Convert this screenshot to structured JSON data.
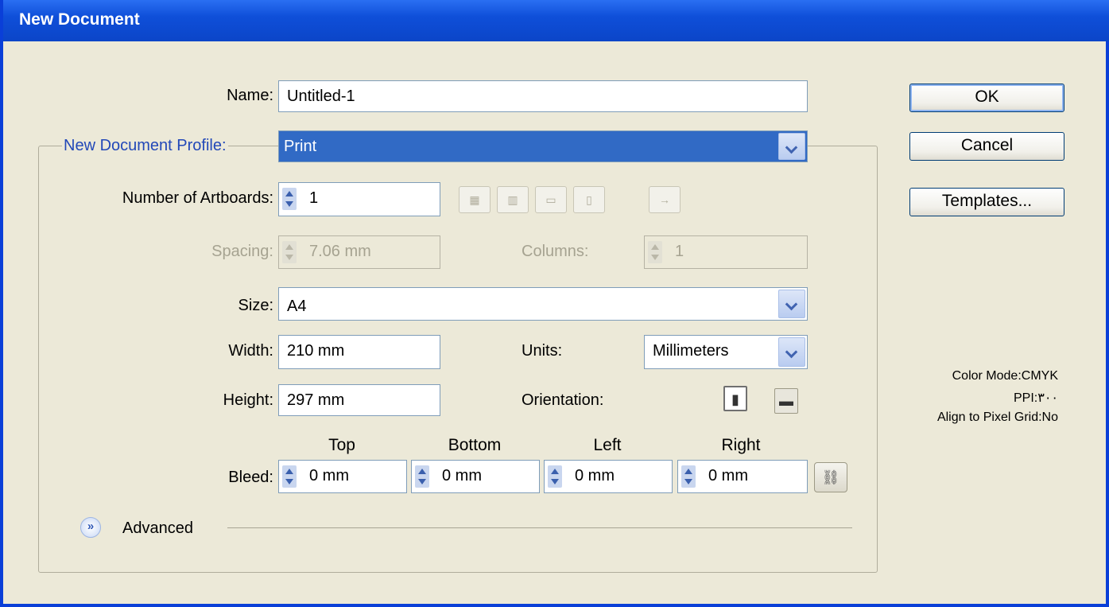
{
  "window": {
    "title": "New Document"
  },
  "name": {
    "label": "Name:",
    "value": "Untitled-1"
  },
  "profile": {
    "label": "New Document Profile:",
    "value": "Print"
  },
  "artboards": {
    "label": "Number of Artboards:",
    "value": "1",
    "arrow": "→"
  },
  "spacing": {
    "label": "Spacing:",
    "value": "7.06 mm"
  },
  "columns": {
    "label": "Columns:",
    "value": "1"
  },
  "size": {
    "label": "Size:",
    "value": "A4"
  },
  "width": {
    "label": "Width:",
    "value": "210 mm"
  },
  "height": {
    "label": "Height:",
    "value": "297 mm"
  },
  "units": {
    "label": "Units:",
    "value": "Millimeters"
  },
  "orientation": {
    "label": "Orientation:"
  },
  "bleed": {
    "label": "Bleed:",
    "columns": [
      "Top",
      "Bottom",
      "Left",
      "Right"
    ],
    "values": [
      "0 mm",
      "0 mm",
      "0 mm",
      "0 mm"
    ]
  },
  "advanced": {
    "label": "Advanced"
  },
  "buttons": {
    "ok": "OK",
    "cancel": "Cancel",
    "templates": "Templates..."
  },
  "info": {
    "color_mode": "Color Mode:CMYK",
    "ppi": "PPI:٣٠٠",
    "align": "Align to Pixel Grid:No"
  },
  "colors": {
    "title_bar": "#0b45c8",
    "dialog_bg": "#ece9d8",
    "selection": "#316ac5",
    "profile_label": "#2248b8"
  }
}
